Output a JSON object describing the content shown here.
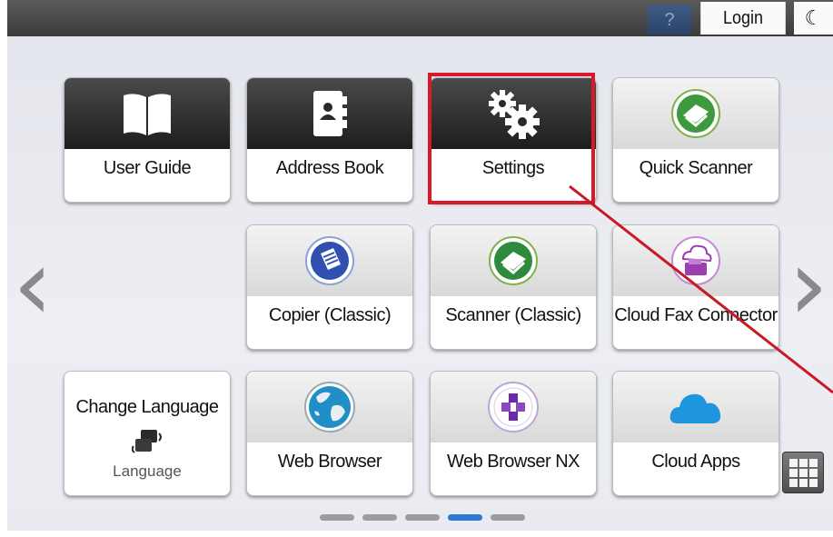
{
  "topbar": {
    "help_label": "?",
    "login_label": "Login",
    "moon_label": "☾"
  },
  "tiles": [
    {
      "label": "User Guide",
      "icon": "book-icon"
    },
    {
      "label": "Address Book",
      "icon": "address-book-icon"
    },
    {
      "label": "Settings",
      "icon": "gears-icon"
    },
    {
      "label": "Quick Scanner",
      "icon": "quick-scanner-icon"
    },
    {
      "label": "Copier (Classic)",
      "icon": "copier-icon"
    },
    {
      "label": "Scanner (Classic)",
      "icon": "scanner-icon"
    },
    {
      "label": "Cloud Fax Connector",
      "icon": "cloud-fax-icon"
    },
    {
      "label": "Web Browser",
      "icon": "globe-icon"
    },
    {
      "label": "Web Browser NX",
      "icon": "puzzle-icon"
    },
    {
      "label": "Cloud Apps",
      "icon": "cloud-icon"
    }
  ],
  "language_tile": {
    "title": "Change Language",
    "sub": "Language",
    "icon": "language-icon"
  },
  "nav": {
    "prev": "‹",
    "next": "›"
  },
  "pager": {
    "count": 5,
    "active_index": 3
  },
  "colors": {
    "highlight": "#d8192a",
    "pager_active": "#2f79d6"
  }
}
